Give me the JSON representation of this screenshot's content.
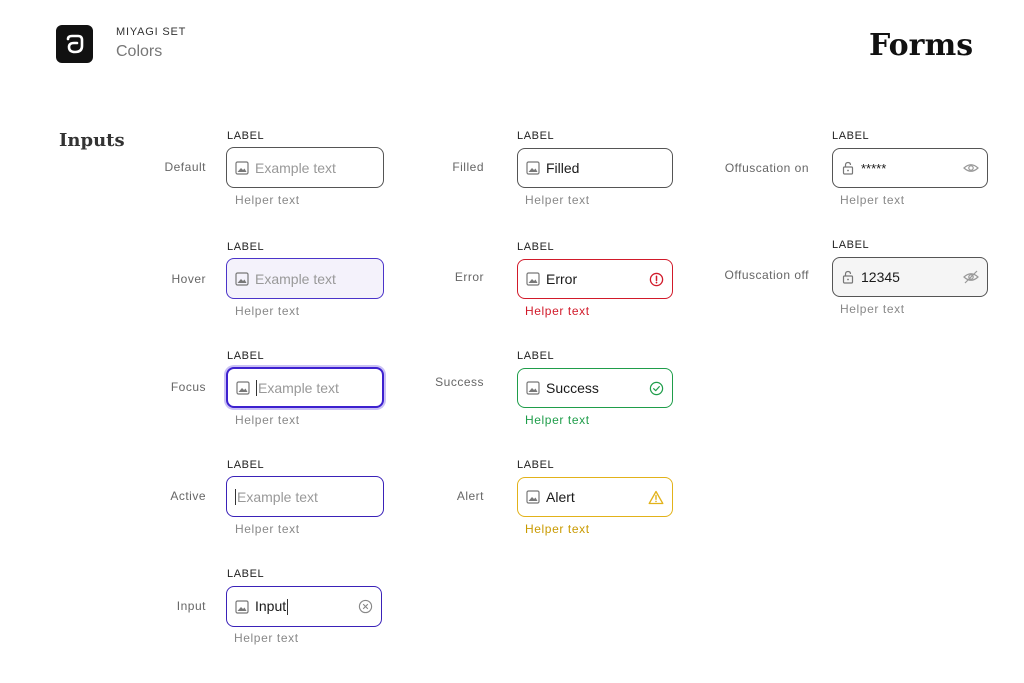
{
  "brand": {
    "name": "MIYAGI SET",
    "subtitle": "Colors"
  },
  "page_title": "Forms",
  "section_title": "Inputs",
  "colors": {
    "primary": "#3d21cf",
    "error": "#d11a2a",
    "success": "#1f9d4a",
    "alert": "#e2b21a",
    "border": "#555555"
  },
  "states": {
    "default": {
      "state": "Default",
      "label": "LABEL",
      "placeholder": "Example text",
      "helper": "Helper text"
    },
    "hover": {
      "state": "Hover",
      "label": "LABEL",
      "placeholder": "Example text",
      "helper": "Helper text"
    },
    "focus": {
      "state": "Focus",
      "label": "LABEL",
      "placeholder": "Example text",
      "helper": "Helper text"
    },
    "active": {
      "state": "Active",
      "label": "LABEL",
      "placeholder": "Example text",
      "helper": "Helper text"
    },
    "input": {
      "state": "Input",
      "label": "LABEL",
      "value": "Input",
      "helper": "Helper text",
      "trailing_icon": "clear-icon"
    },
    "filled": {
      "state": "Filled",
      "label": "LABEL",
      "value": "Filled",
      "helper": "Helper text"
    },
    "error": {
      "state": "Error",
      "label": "LABEL",
      "value": "Error",
      "helper": "Helper text",
      "trailing_icon": "error-icon"
    },
    "success": {
      "state": "Success",
      "label": "LABEL",
      "value": "Success",
      "helper": "Helper text",
      "trailing_icon": "check-circle-icon"
    },
    "alert": {
      "state": "Alert",
      "label": "LABEL",
      "value": "Alert",
      "helper": "Helper text",
      "trailing_icon": "warning-icon"
    },
    "obfuscation_on": {
      "state": "Offuscation on",
      "label": "LABEL",
      "value": "*****",
      "helper": "Helper text",
      "trailing_icon": "eye-icon"
    },
    "obfuscation_off": {
      "state": "Offuscation off",
      "label": "LABEL",
      "value": "12345",
      "helper": "Helper text",
      "trailing_icon": "eye-off-icon"
    }
  }
}
